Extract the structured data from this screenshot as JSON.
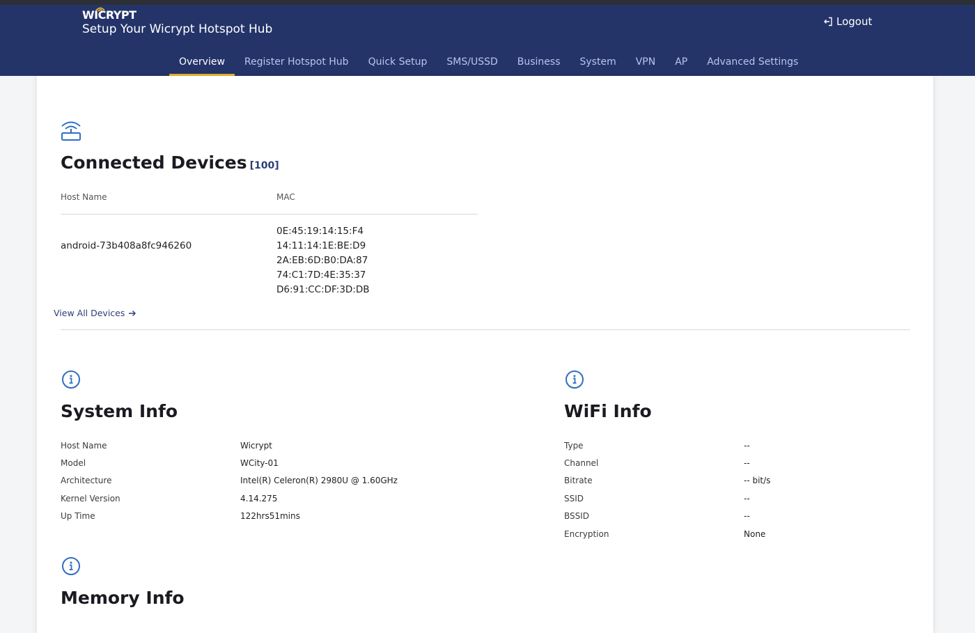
{
  "app": {
    "logo_text": "WICRYPT",
    "subtitle": "Setup Your Wicrypt Hotspot Hub",
    "logout_label": "Logout"
  },
  "nav": {
    "items": [
      {
        "label": "Overview",
        "active": true
      },
      {
        "label": "Register Hotspot Hub",
        "active": false
      },
      {
        "label": "Quick Setup",
        "active": false
      },
      {
        "label": "SMS/USSD",
        "active": false
      },
      {
        "label": "Business",
        "active": false
      },
      {
        "label": "System",
        "active": false
      },
      {
        "label": "VPN",
        "active": false
      },
      {
        "label": "AP",
        "active": false
      },
      {
        "label": "Advanced Settings",
        "active": false
      }
    ]
  },
  "connected_devices": {
    "title": "Connected Devices",
    "count": "[100]",
    "headers": {
      "host_name": "Host Name",
      "mac": "MAC"
    },
    "rows": [
      {
        "host_name": "android-73b408a8fc946260",
        "macs": [
          "0E:45:19:14:15:F4",
          "14:11:14:1E:BE:D9",
          "2A:EB:6D:B0:DA:87",
          "74:C1:7D:4E:35:37",
          "D6:91:CC:DF:3D:DB"
        ]
      }
    ],
    "view_all_label": "View All Devices"
  },
  "system_info": {
    "title": "System Info",
    "rows": [
      {
        "label": "Host Name",
        "value": "Wicrypt"
      },
      {
        "label": "Model",
        "value": "WCity-01"
      },
      {
        "label": "Architecture",
        "value": "Intel(R) Celeron(R) 2980U @ 1.60GHz"
      },
      {
        "label": "Kernel Version",
        "value": "4.14.275"
      },
      {
        "label": "Up Time",
        "value": "122hrs51mins"
      }
    ]
  },
  "wifi_info": {
    "title": "WiFi Info",
    "rows": [
      {
        "label": "Type",
        "value": "--"
      },
      {
        "label": "Channel",
        "value": "--"
      },
      {
        "label": "Bitrate",
        "value": "-- bit/s"
      },
      {
        "label": "SSID",
        "value": "--"
      },
      {
        "label": "BSSID",
        "value": "--"
      },
      {
        "label": "Encryption",
        "value": "None"
      }
    ]
  },
  "memory_info": {
    "title": "Memory Info"
  },
  "colors": {
    "header_bg": "#243469",
    "accent": "#e8b631",
    "link": "#2b3c7a",
    "icon_blue": "#2f6fc0"
  },
  "icons": {
    "router": "router-icon",
    "info": "info-icon",
    "logout": "logout-icon",
    "arrow": "arrow-right-icon"
  }
}
